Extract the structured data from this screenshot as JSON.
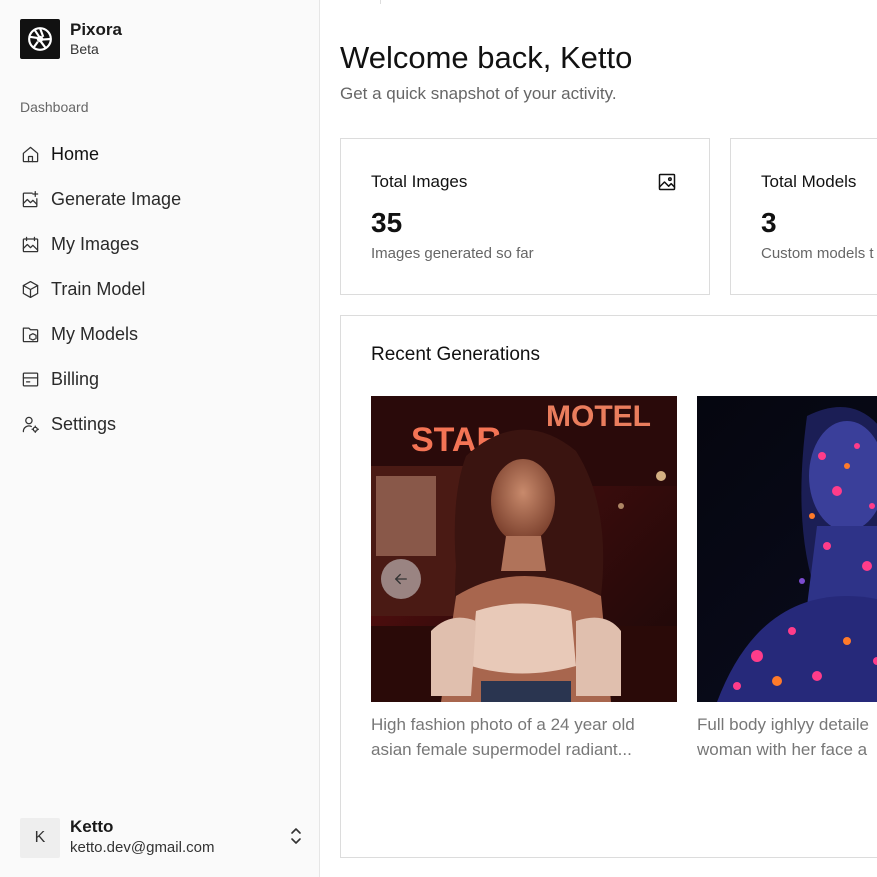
{
  "brand": {
    "name": "Pixora",
    "badge": "Beta"
  },
  "sidebar": {
    "section_label": "Dashboard",
    "items": [
      {
        "label": "Home",
        "icon": "home-icon",
        "active": true
      },
      {
        "label": "Generate Image",
        "icon": "image-sparkle-icon"
      },
      {
        "label": "My Images",
        "icon": "images-icon"
      },
      {
        "label": "Train Model",
        "icon": "box-icon"
      },
      {
        "label": "My Models",
        "icon": "folder-model-icon"
      },
      {
        "label": "Billing",
        "icon": "billing-icon"
      },
      {
        "label": "Settings",
        "icon": "user-settings-icon"
      }
    ]
  },
  "user": {
    "initial": "K",
    "name": "Ketto",
    "email": "ketto.dev@gmail.com",
    "icon": "chevrons-up-down-icon"
  },
  "header": {
    "title": "Welcome back, Ketto",
    "subtitle": "Get a quick snapshot of your activity."
  },
  "stats": [
    {
      "label": "Total Images",
      "value": "35",
      "description": "Images generated so far",
      "icon": "image-icon"
    },
    {
      "label": "Total Models",
      "value": "3",
      "description": "Custom models t"
    }
  ],
  "recent": {
    "title": "Recent Generations",
    "prev_icon": "arrow-left-icon",
    "items": [
      {
        "caption_line1": "High fashion photo of a 24 year old",
        "caption_line2": "asian female supermodel radiant..."
      },
      {
        "caption_line1": "Full body ighlyy detaile",
        "caption_line2": "woman with her face a"
      }
    ]
  },
  "colors": {
    "sidebar_bg": "#fafafa",
    "brand_logo_bg": "#111111",
    "muted_text": "#666666",
    "card_border": "#dcdcdc"
  }
}
